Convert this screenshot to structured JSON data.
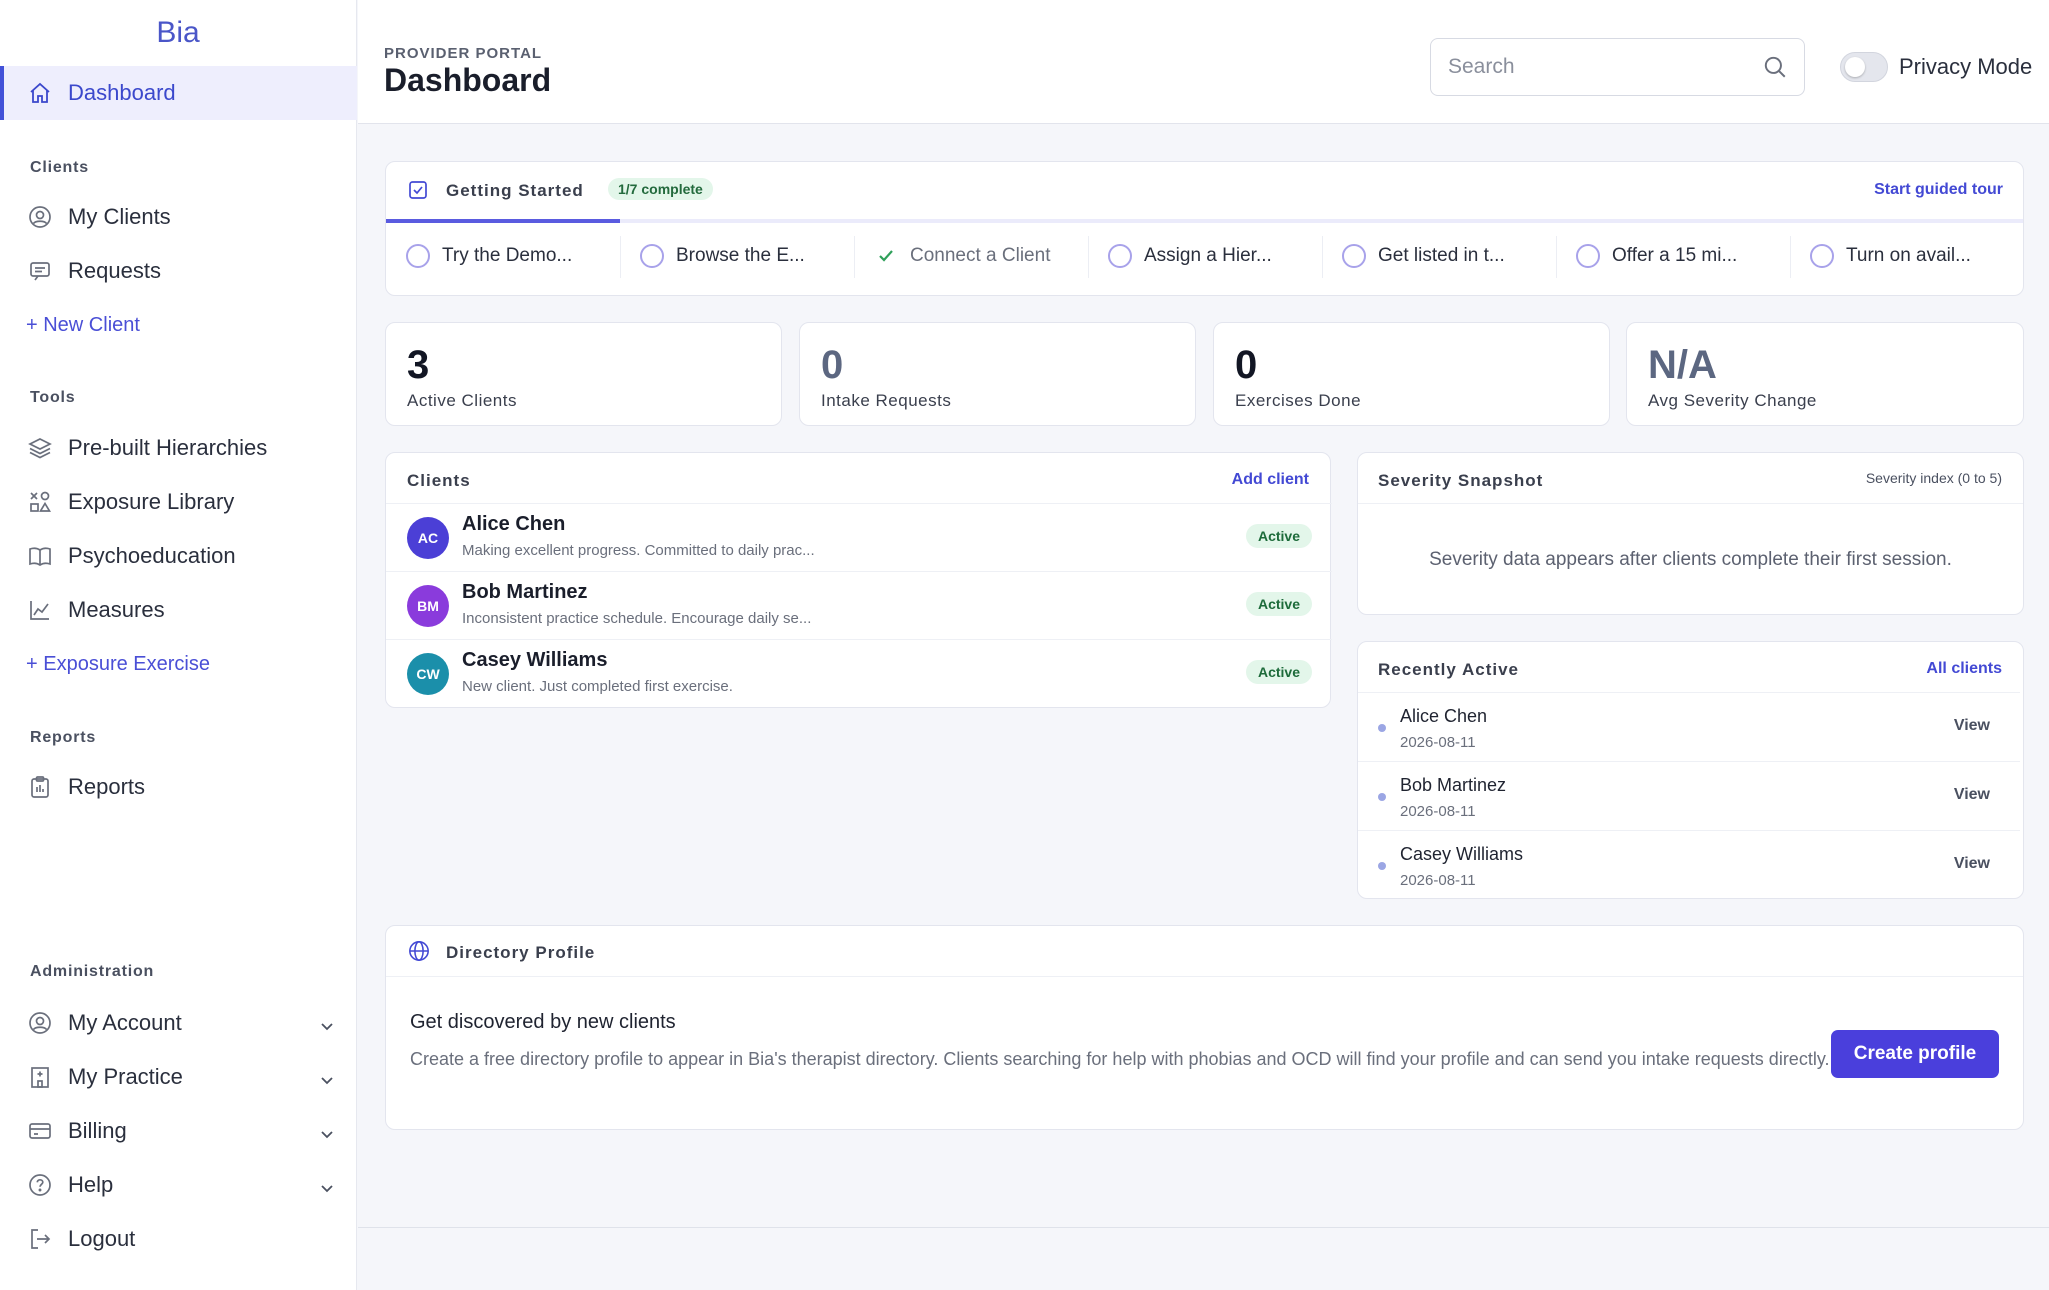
{
  "app": {
    "name": "Bia"
  },
  "sidebar": {
    "dashboard": "Dashboard",
    "sections": {
      "clients": "Clients",
      "tools": "Tools",
      "reports": "Reports",
      "administration": "Administration"
    },
    "clients_items": [
      "My Clients",
      "Requests",
      "+ New Client"
    ],
    "tools_items": [
      "Pre-built Hierarchies",
      "Exposure Library",
      "Psychoeducation",
      "Measures",
      "+ Exposure Exercise"
    ],
    "reports_items": [
      "Reports"
    ],
    "admin_items": [
      "My Account",
      "My Practice",
      "Billing",
      "Help",
      "Logout"
    ]
  },
  "header": {
    "eyebrow": "PROVIDER PORTAL",
    "title": "Dashboard",
    "search_placeholder": "Search",
    "privacy_label": "Privacy Mode",
    "privacy_on": false
  },
  "getting_started": {
    "title": "Getting Started",
    "progress_label": "1/7 complete",
    "progress_fraction": 0.143,
    "tour_link": "Start guided tour",
    "steps": [
      {
        "label": "Try the Demo...",
        "done": false
      },
      {
        "label": "Browse the E...",
        "done": false
      },
      {
        "label": "Connect a Client",
        "done": true
      },
      {
        "label": "Assign a Hier...",
        "done": false
      },
      {
        "label": "Get listed in t...",
        "done": false
      },
      {
        "label": "Offer a 15 mi...",
        "done": false
      },
      {
        "label": "Turn on avail...",
        "done": false
      }
    ]
  },
  "stats": [
    {
      "value": "3",
      "label": "Active Clients"
    },
    {
      "value": "0",
      "label": "Intake Requests"
    },
    {
      "value": "0",
      "label": "Exercises Done"
    },
    {
      "value": "N/A",
      "label": "Avg Severity Change"
    }
  ],
  "clients": {
    "title": "Clients",
    "add_link": "Add client",
    "rows": [
      {
        "initials": "AC",
        "name": "Alice Chen",
        "note": "Making excellent progress. Committed to daily prac...",
        "status": "Active",
        "color": "#4b3fd6"
      },
      {
        "initials": "BM",
        "name": "Bob Martinez",
        "note": "Inconsistent practice schedule. Encourage daily se...",
        "status": "Active",
        "color": "#8a3bdc"
      },
      {
        "initials": "CW",
        "name": "Casey Williams",
        "note": "New client. Just completed first exercise.",
        "status": "Active",
        "color": "#1b8faa"
      }
    ]
  },
  "severity": {
    "title": "Severity Snapshot",
    "scale_label": "Severity index (0 to 5)",
    "empty_text": "Severity data appears after clients complete their first session."
  },
  "recently_active": {
    "title": "Recently Active",
    "all_link": "All clients",
    "rows": [
      {
        "name": "Alice Chen",
        "date": "2026-08-11",
        "action": "View"
      },
      {
        "name": "Bob Martinez",
        "date": "2026-08-11",
        "action": "View"
      },
      {
        "name": "Casey Williams",
        "date": "2026-08-11",
        "action": "View"
      }
    ]
  },
  "directory": {
    "title": "Directory Profile",
    "heading": "Get discovered by new clients",
    "body": "Create a free directory profile to appear in Bia's therapist directory. Clients searching for help with phobias and OCD will find your profile and can send you intake requests directly.",
    "button": "Create profile"
  },
  "colors": {
    "accent": "#4a3fdc",
    "accent_text": "#3b48cc",
    "success_bg": "#e3f6ea",
    "success_text": "#1d6b3a"
  },
  "icons": {
    "dashboard": "home-icon",
    "my_clients": "user-circle-icon",
    "requests": "message-icon",
    "hierarchies": "layers-icon",
    "exposure_library": "shapes-icon",
    "psychoeducation": "book-icon",
    "measures": "chart-line-icon",
    "reports": "clipboard-icon",
    "my_account": "user-circle-icon",
    "my_practice": "building-icon",
    "billing": "credit-card-icon",
    "help": "help-circle-icon",
    "logout": "logout-icon",
    "search": "search-icon",
    "getting_started": "checkbox-icon",
    "directory": "globe-icon"
  }
}
